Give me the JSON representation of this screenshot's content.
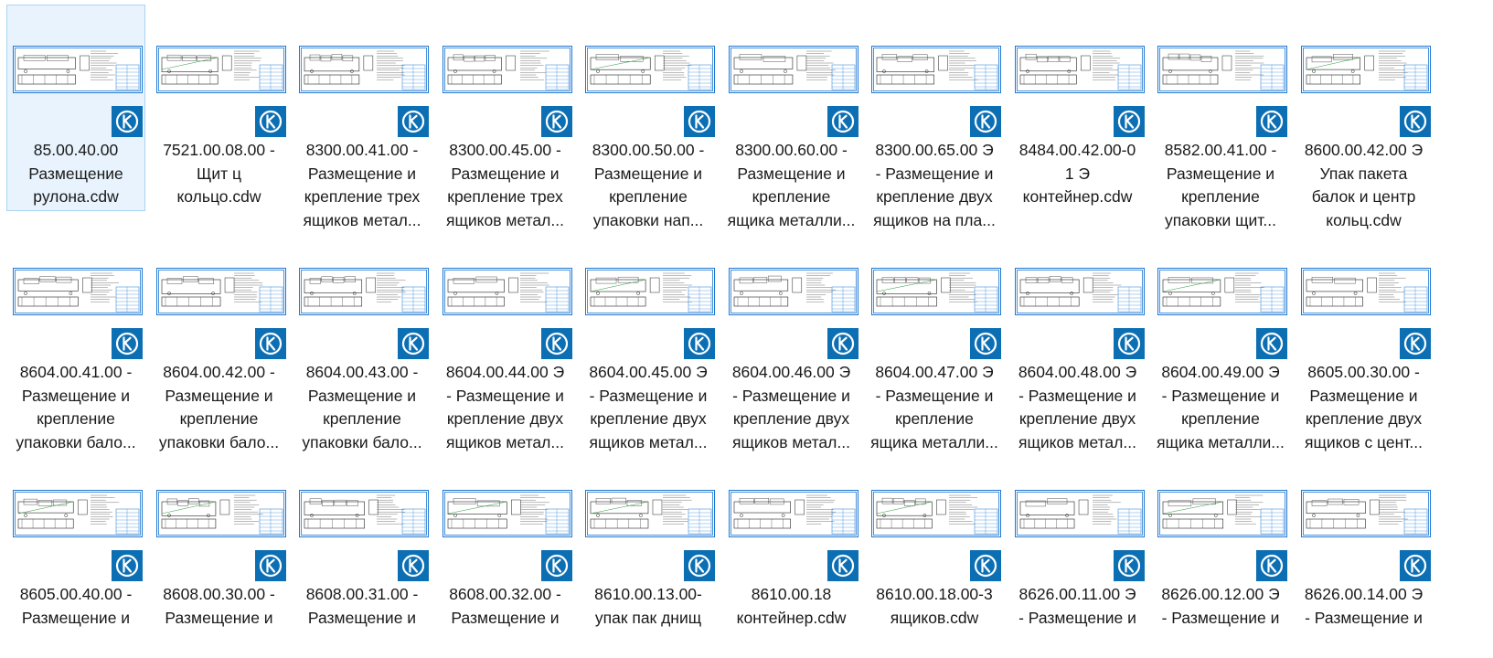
{
  "colors": {
    "selected_bg": "#e8f3fd",
    "selected_border": "#a9d4f3",
    "thumb_border": "#1e78d2",
    "badge_bg": "#0d6fb3",
    "text": "#1a1a1a"
  },
  "icons": {
    "badge": "kompas-cdw-icon",
    "preview": "drawing-preview"
  },
  "files": [
    {
      "lines": [
        "85.00.40.00",
        "Размещение",
        "рулона.cdw"
      ],
      "selected": true
    },
    {
      "lines": [
        "7521.00.08.00 -",
        "Щит ц",
        "кольцо.cdw"
      ]
    },
    {
      "lines": [
        "8300.00.41.00 -",
        "Размещение и",
        "крепление трех",
        "ящиков метал..."
      ]
    },
    {
      "lines": [
        "8300.00.45.00 -",
        "Размещение и",
        "крепление трех",
        "ящиков метал..."
      ]
    },
    {
      "lines": [
        "8300.00.50.00 -",
        "Размещение и",
        "крепление",
        "упаковки нап..."
      ]
    },
    {
      "lines": [
        "8300.00.60.00 -",
        "Размещение и",
        "крепление",
        "ящика металли..."
      ]
    },
    {
      "lines": [
        "8300.00.65.00 Э",
        "- Размещение и",
        "крепление двух",
        "ящиков на пла..."
      ]
    },
    {
      "lines": [
        "8484.00.42.00-0",
        "1 Э",
        "контейнер.cdw"
      ]
    },
    {
      "lines": [
        "8582.00.41.00 -",
        "Размещение и",
        "крепление",
        "упаковки щит..."
      ]
    },
    {
      "lines": [
        "8600.00.42.00 Э",
        "Упак пакета",
        "балок и центр",
        "кольц.cdw"
      ]
    },
    {
      "lines": [
        "8604.00.41.00 -",
        "Размещение и",
        "крепление",
        "упаковки бало..."
      ]
    },
    {
      "lines": [
        "8604.00.42.00 -",
        "Размещение и",
        "крепление",
        "упаковки бало..."
      ]
    },
    {
      "lines": [
        "8604.00.43.00 -",
        "Размещение и",
        "крепление",
        "упаковки бало..."
      ]
    },
    {
      "lines": [
        "8604.00.44.00 Э",
        "- Размещение и",
        "крепление двух",
        "ящиков метал..."
      ]
    },
    {
      "lines": [
        "8604.00.45.00 Э",
        "- Размещение и",
        "крепление двух",
        "ящиков метал..."
      ]
    },
    {
      "lines": [
        "8604.00.46.00 Э",
        "- Размещение и",
        "крепление двух",
        "ящиков метал..."
      ]
    },
    {
      "lines": [
        "8604.00.47.00 Э",
        "- Размещение и",
        "крепление",
        "ящика металли..."
      ]
    },
    {
      "lines": [
        "8604.00.48.00 Э",
        "- Размещение и",
        "крепление двух",
        "ящиков метал..."
      ]
    },
    {
      "lines": [
        "8604.00.49.00 Э",
        "- Размещение и",
        "крепление",
        "ящика металли..."
      ]
    },
    {
      "lines": [
        "8605.00.30.00 -",
        "Размещение и",
        "крепление двух",
        "ящиков с цент..."
      ]
    },
    {
      "lines": [
        "8605.00.40.00 -",
        "Размещение и"
      ]
    },
    {
      "lines": [
        "8608.00.30.00 -",
        "Размещение и"
      ]
    },
    {
      "lines": [
        "8608.00.31.00 -",
        "Размещение и"
      ]
    },
    {
      "lines": [
        "8608.00.32.00 -",
        "Размещение и"
      ]
    },
    {
      "lines": [
        "8610.00.13.00-",
        "упак пак днищ"
      ]
    },
    {
      "lines": [
        "8610.00.18",
        "контейнер.cdw"
      ]
    },
    {
      "lines": [
        "8610.00.18.00-3",
        "ящиков.cdw"
      ]
    },
    {
      "lines": [
        "8626.00.11.00 Э",
        "- Размещение и"
      ]
    },
    {
      "lines": [
        "8626.00.12.00 Э",
        "-  Размещение и"
      ]
    },
    {
      "lines": [
        "8626.00.14.00 Э",
        "- Размещение и"
      ]
    }
  ]
}
